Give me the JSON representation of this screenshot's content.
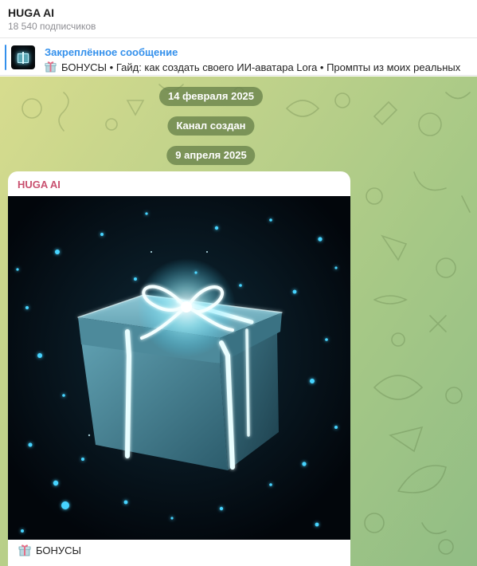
{
  "header": {
    "title": "HUGA AI",
    "subscribers": "18 540 подписчиков"
  },
  "pinned": {
    "title": "Закреплённое сообщение",
    "text": "БОНУСЫ  • Гайд: как создать своего ИИ-аватара Lora  • Промпты из моих реальных"
  },
  "chat": {
    "service_messages": [
      "14 февраля 2025",
      "Канал создан",
      "9 апреля 2025"
    ],
    "post": {
      "author": "HUGA AI",
      "caption": "БОНУСЫ",
      "image": "glowing-gift-box-image"
    }
  },
  "colors": {
    "accent": "#3390ec",
    "author": "#c9506f",
    "date_pill": "#68824a",
    "glow": "#7fe9ff"
  }
}
